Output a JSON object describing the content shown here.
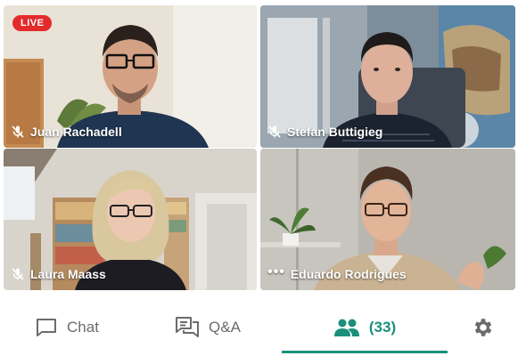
{
  "live_badge": "LIVE",
  "participants": [
    {
      "name": "Juan Rachadell",
      "status": "muted"
    },
    {
      "name": "Stefan Buttigieg",
      "status": "muted"
    },
    {
      "name": "Laura Maass",
      "status": "muted"
    },
    {
      "name": "Eduardo Rodrigues",
      "status": "more-options"
    }
  ],
  "more_glyph": "•••",
  "tabs": {
    "chat": {
      "label": "Chat",
      "icon": "chat-bubble-icon"
    },
    "qa": {
      "label": "Q&A",
      "icon": "qa-icon"
    },
    "people": {
      "label": "(33)",
      "icon": "people-icon",
      "active": true
    },
    "settings": {
      "icon": "gear-icon"
    }
  },
  "colors": {
    "accent": "#1b8f7c",
    "live": "#e32b2b",
    "tab_inactive": "#6b6b6b"
  }
}
